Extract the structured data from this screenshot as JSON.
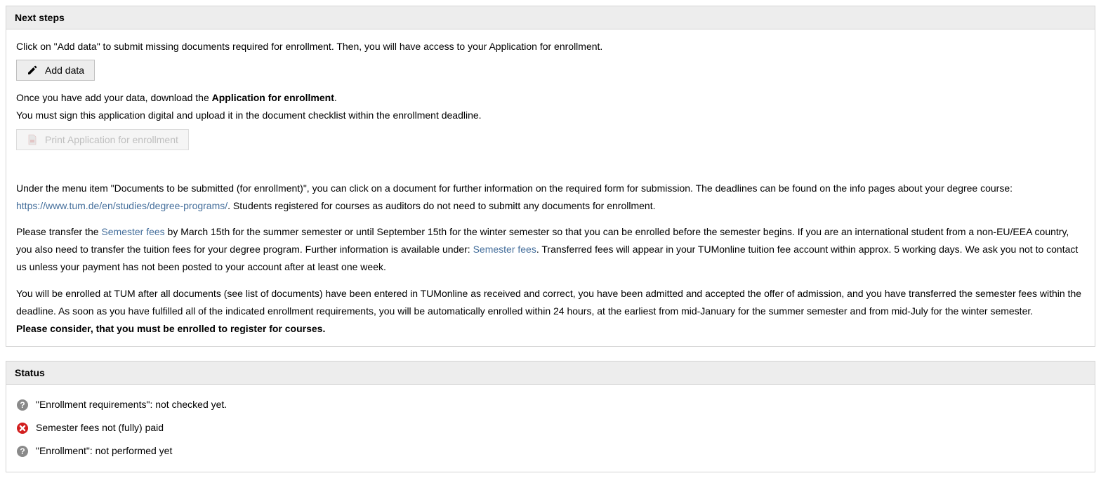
{
  "next_steps": {
    "title": "Next steps",
    "intro": "Click on \"Add data\" to submit missing documents required for enrollment. Then, you will have access to your Application for enrollment.",
    "add_data_label": "Add data",
    "after_add_prefix": "Once you have add your data, download the ",
    "after_add_bold": "Application for enrollment",
    "after_add_suffix": ".",
    "sign_upload": "You must sign this application digital and upload it in the document checklist within the enrollment deadline.",
    "print_label": "Print Application for enrollment",
    "docs_prefix": "Under the menu item \"Documents to be submitted (for enrollment)\", you can click on a document for further information on the required form for submission. The deadlines can be found on the info pages about your degree course: ",
    "docs_link": "https://www.tum.de/en/studies/degree-programs/",
    "docs_suffix": ". Students registered for courses as auditors do not need to submitt any documents for enrollment.",
    "fees_p1": "Please transfer the ",
    "fees_link1": "Semester fees",
    "fees_p2": " by March 15th for the summer semester or until September 15th for the winter semester so that you can be enrolled before the semester begins. If you are an international student from a non-EU/EEA country, you also need to transfer the tuition fees for your degree program. Further information is available under: ",
    "fees_link2": "Semester fees",
    "fees_p3": ". Transferred fees will appear in your TUMonline tuition fee account within approx. 5 working days. We ask you not to contact us unless your payment has not been posted to your account after at least one week.",
    "enroll_p": "You will be enrolled at TUM after all documents (see list of documents) have been entered in TUMonline as received and correct, you have been admitted and accepted the offer of admission, and you have transferred the semester fees within the deadline. As soon as you have fulfilled all of the indicated enrollment requirements, you will be automatically enrolled within 24 hours, at the earliest from mid-January for the summer semester and from mid-July for the winter semester.",
    "consider_bold": "Please consider, that you must be enrolled to register for courses."
  },
  "status": {
    "title": "Status",
    "items": [
      {
        "icon": "question",
        "text": "\"Enrollment requirements\": not checked yet."
      },
      {
        "icon": "error",
        "text": "Semester fees not (fully) paid"
      },
      {
        "icon": "question",
        "text": "\"Enrollment\": not performed yet"
      }
    ]
  }
}
